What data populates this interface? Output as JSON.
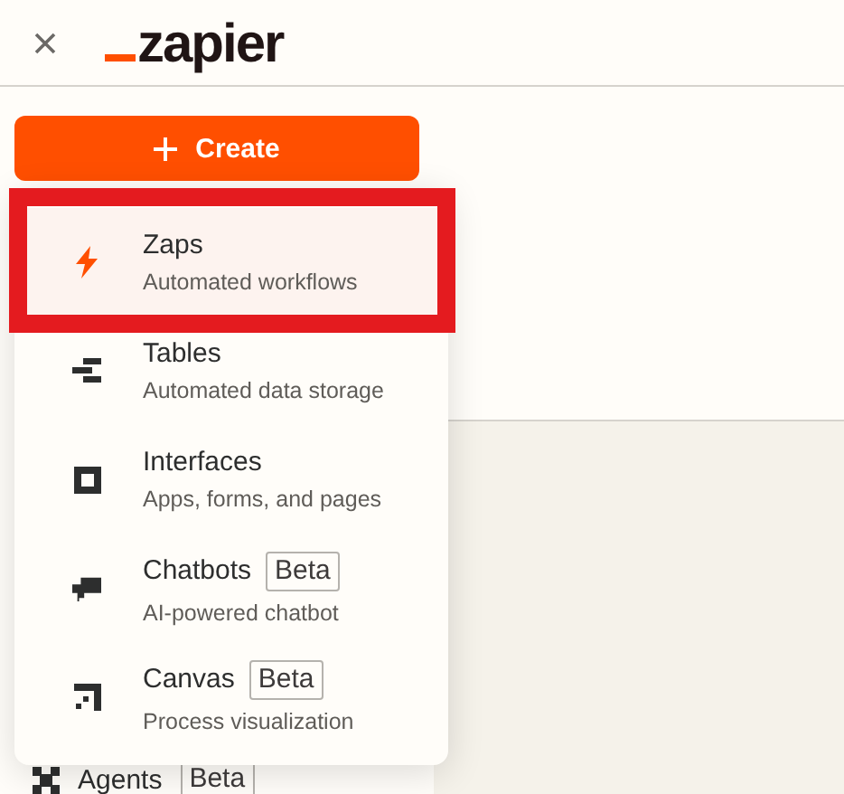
{
  "header": {
    "logo": "zapier"
  },
  "create_button": {
    "label": "Create"
  },
  "create_menu": [
    {
      "title": "Zaps",
      "subtitle": "Automated workflows",
      "selected": true,
      "annotated": true
    },
    {
      "title": "Tables",
      "subtitle": "Automated data storage",
      "selected": false,
      "annotated": false
    },
    {
      "title": "Interfaces",
      "subtitle": "Apps, forms, and pages",
      "selected": false,
      "annotated": false
    },
    {
      "title": "Chatbots",
      "badge": "Beta",
      "subtitle": "AI-powered chatbot",
      "selected": false,
      "annotated": false
    },
    {
      "title": "Canvas",
      "badge": "Beta",
      "subtitle": "Process visualization",
      "selected": false,
      "annotated": false
    }
  ],
  "sidebar_items": [
    {
      "label": "Agents",
      "badge": "Beta"
    }
  ]
}
